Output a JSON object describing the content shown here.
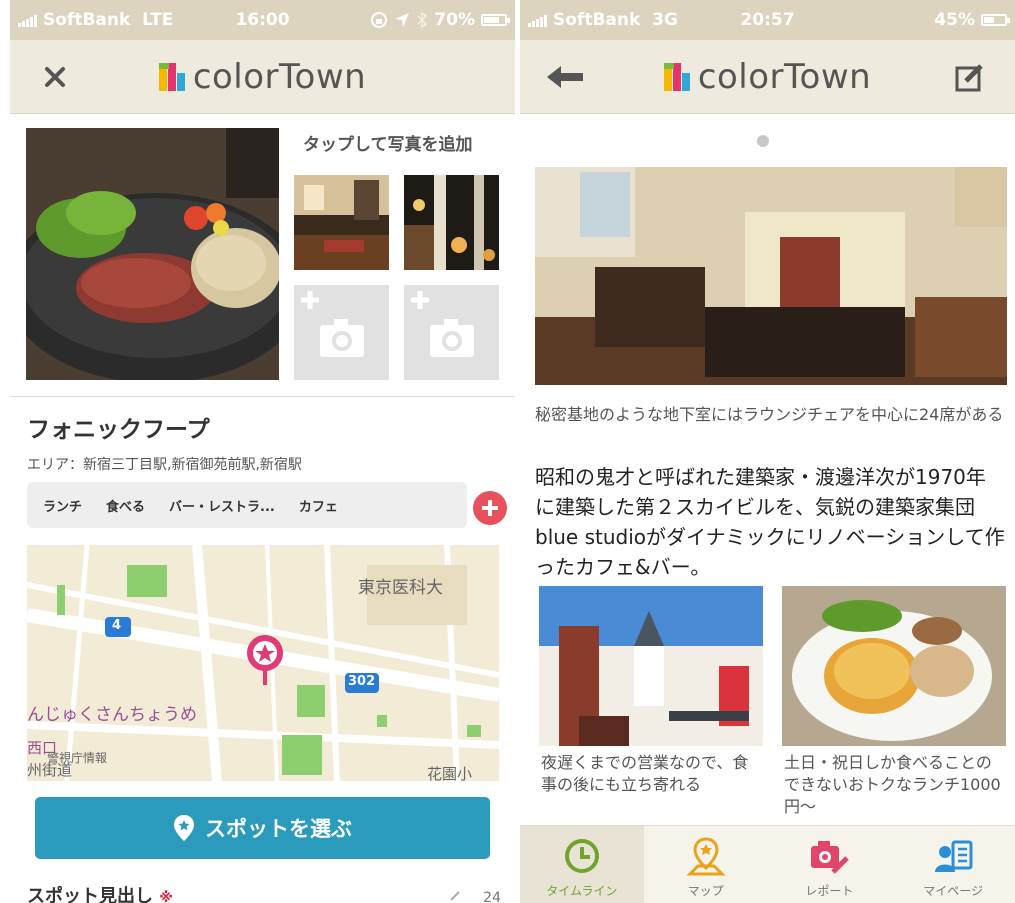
{
  "left_screen": {
    "status": {
      "carrier": "SoftBank",
      "network": "LTE",
      "time": "16:00",
      "battery": "70%",
      "battery_fraction": 0.7
    },
    "header": {
      "logo_text": "colorTown",
      "close_icon": "close-icon"
    },
    "photos": {
      "hint": "タップして写真を追加"
    },
    "spot": {
      "name": "フォニックフープ",
      "area": "エリア：新宿三丁目駅,新宿御苑前駅,新宿駅",
      "tags": [
        "ランチ",
        "食べる",
        "バー・レストラ...",
        "カフェ"
      ]
    },
    "map": {
      "labels": [
        "東京医科大",
        "んじゅくさんちょうめ",
        "花園小",
        "西口",
        "州街道",
        "警視庁情報"
      ],
      "route_badges": [
        "4",
        "302"
      ]
    },
    "choose_spot_label": "スポットを選ぶ",
    "heading_field": {
      "label": "スポット見出し",
      "required_mark": "※",
      "count": "24"
    }
  },
  "right_screen": {
    "status": {
      "carrier": "SoftBank",
      "network": "3G",
      "time": "20:57",
      "battery": "45%",
      "battery_fraction": 0.45
    },
    "header": {
      "logo_text": "colorTown"
    },
    "hero_caption": "秘密基地のような地下室にはラウンジチェアを中心に24席がある",
    "description": "昭和の鬼才と呼ばれた建築家・渡邊洋次が1970年に建築した第２スカイビルを、気鋭の建築家集団blue studioがダイナミックにリノベーションして作ったカフェ&バー。",
    "cards": [
      {
        "text": "夜遅くまでの営業なので、食事の後にも立ち寄れる"
      },
      {
        "text": "土日・祝日しか食べることのできないおトクなランチ1000円〜"
      }
    ],
    "tabs": [
      {
        "label": "タイムライン",
        "icon": "clock-icon",
        "active": true
      },
      {
        "label": "マップ",
        "icon": "map-pin-icon",
        "active": false
      },
      {
        "label": "レポート",
        "icon": "camera-pencil-icon",
        "active": false
      },
      {
        "label": "マイページ",
        "icon": "profile-icon",
        "active": false
      }
    ]
  },
  "colors": {
    "accent_blue": "#2a9bbd",
    "tab_green": "#6fa52b",
    "add_red": "#e8505b",
    "header_bg": "#efeade",
    "status_bg": "#ddd4c0"
  }
}
